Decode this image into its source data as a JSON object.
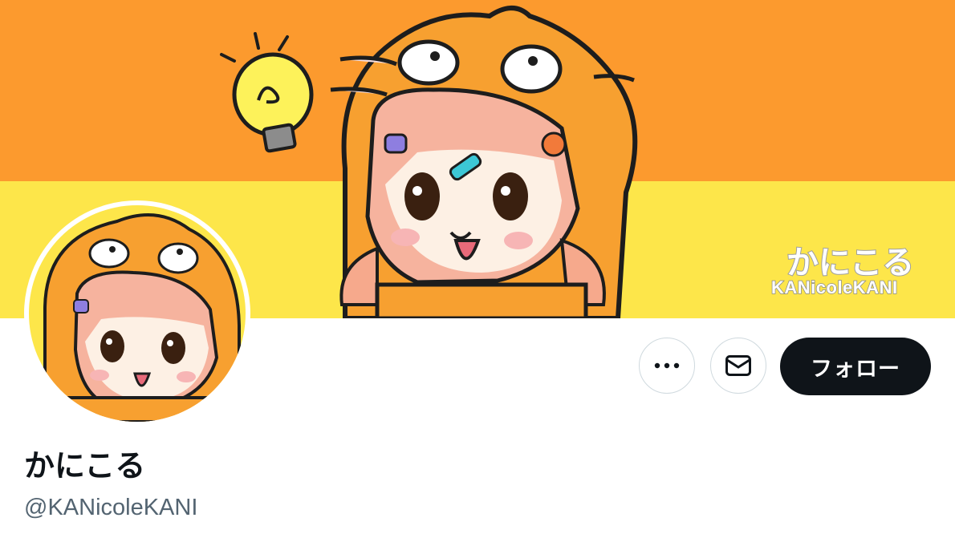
{
  "profile": {
    "display_name": "かにこる",
    "handle": "@KANicoleKANI"
  },
  "banner": {
    "logo_text_jp": "かにこる",
    "logo_text_en": "KANicoleKANI"
  },
  "actions": {
    "more_icon": "more-horizontal-icon",
    "message_icon": "envelope-icon",
    "follow_label": "フォロー"
  },
  "colors": {
    "banner_orange": "#fc9a2e",
    "banner_yellow": "#fde64a",
    "follow_bg": "#0f1419",
    "handle_text": "#536471"
  }
}
